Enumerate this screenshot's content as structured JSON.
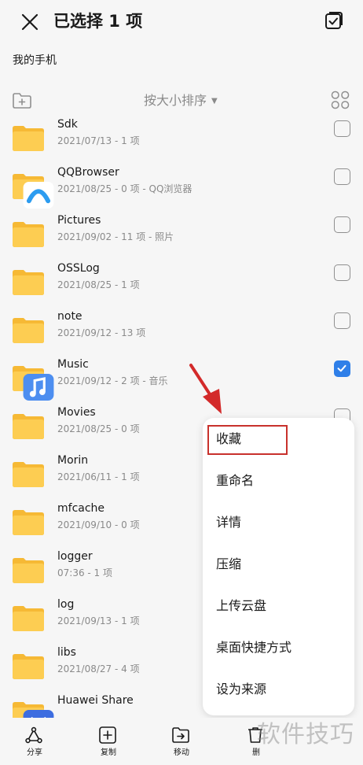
{
  "header": {
    "title": "已选择 1 项",
    "close_icon": "close-icon",
    "select_all_icon": "select-all-icon"
  },
  "breadcrumb": {
    "path": "我的手机"
  },
  "toolbar": {
    "sort_label": "按大小排序",
    "new_folder_icon": "new-folder-icon",
    "grid_icon": "grid-view-icon"
  },
  "colors": {
    "folder": "#fdcd52",
    "folder_back": "#f6b935",
    "accent": "#2f7fe8",
    "highlight_box": "#c8312c",
    "arrow": "#d32a2a"
  },
  "files": [
    {
      "name": "Sdk",
      "meta": "2021/07/13 - 1 项",
      "selected": false,
      "badge": ""
    },
    {
      "name": "QQBrowser",
      "meta": "2021/08/25 - 0 项 - QQ浏览器",
      "selected": false,
      "badge": "qq-browser-icon"
    },
    {
      "name": "Pictures",
      "meta": "2021/09/02 - 11 项 - 照片",
      "selected": false,
      "badge": ""
    },
    {
      "name": "OSSLog",
      "meta": "2021/08/25 - 1 项",
      "selected": false,
      "badge": ""
    },
    {
      "name": "note",
      "meta": "2021/09/12 - 13 项",
      "selected": false,
      "badge": ""
    },
    {
      "name": "Music",
      "meta": "2021/09/12 - 2 项 - 音乐",
      "selected": true,
      "badge": "music-icon"
    },
    {
      "name": "Movies",
      "meta": "2021/08/25 - 0 项",
      "selected": false,
      "badge": ""
    },
    {
      "name": "Morin",
      "meta": "2021/06/11 - 1 项",
      "selected": false,
      "badge": ""
    },
    {
      "name": "mfcache",
      "meta": "2021/09/10 - 0 项",
      "selected": false,
      "badge": ""
    },
    {
      "name": "logger",
      "meta": "07:36 - 1 项",
      "selected": false,
      "badge": ""
    },
    {
      "name": "log",
      "meta": "2021/09/13 - 1 项",
      "selected": false,
      "badge": ""
    },
    {
      "name": "libs",
      "meta": "2021/08/27 - 4 项",
      "selected": false,
      "badge": ""
    },
    {
      "name": "Huawei Share",
      "meta": "",
      "selected": false,
      "badge": "huawei-share-icon"
    }
  ],
  "popup_menu": {
    "items": [
      "收藏",
      "重命名",
      "详情",
      "压缩",
      "上传云盘",
      "桌面快捷方式",
      "设为来源"
    ],
    "highlighted_item": "收藏"
  },
  "bottom_bar": {
    "tabs": [
      {
        "label": "分享",
        "icon": "share-icon"
      },
      {
        "label": "复制",
        "icon": "copy-icon"
      },
      {
        "label": "移动",
        "icon": "move-icon"
      },
      {
        "label": "删",
        "icon": "delete-icon"
      }
    ]
  },
  "watermark": {
    "text": "软件技巧"
  }
}
